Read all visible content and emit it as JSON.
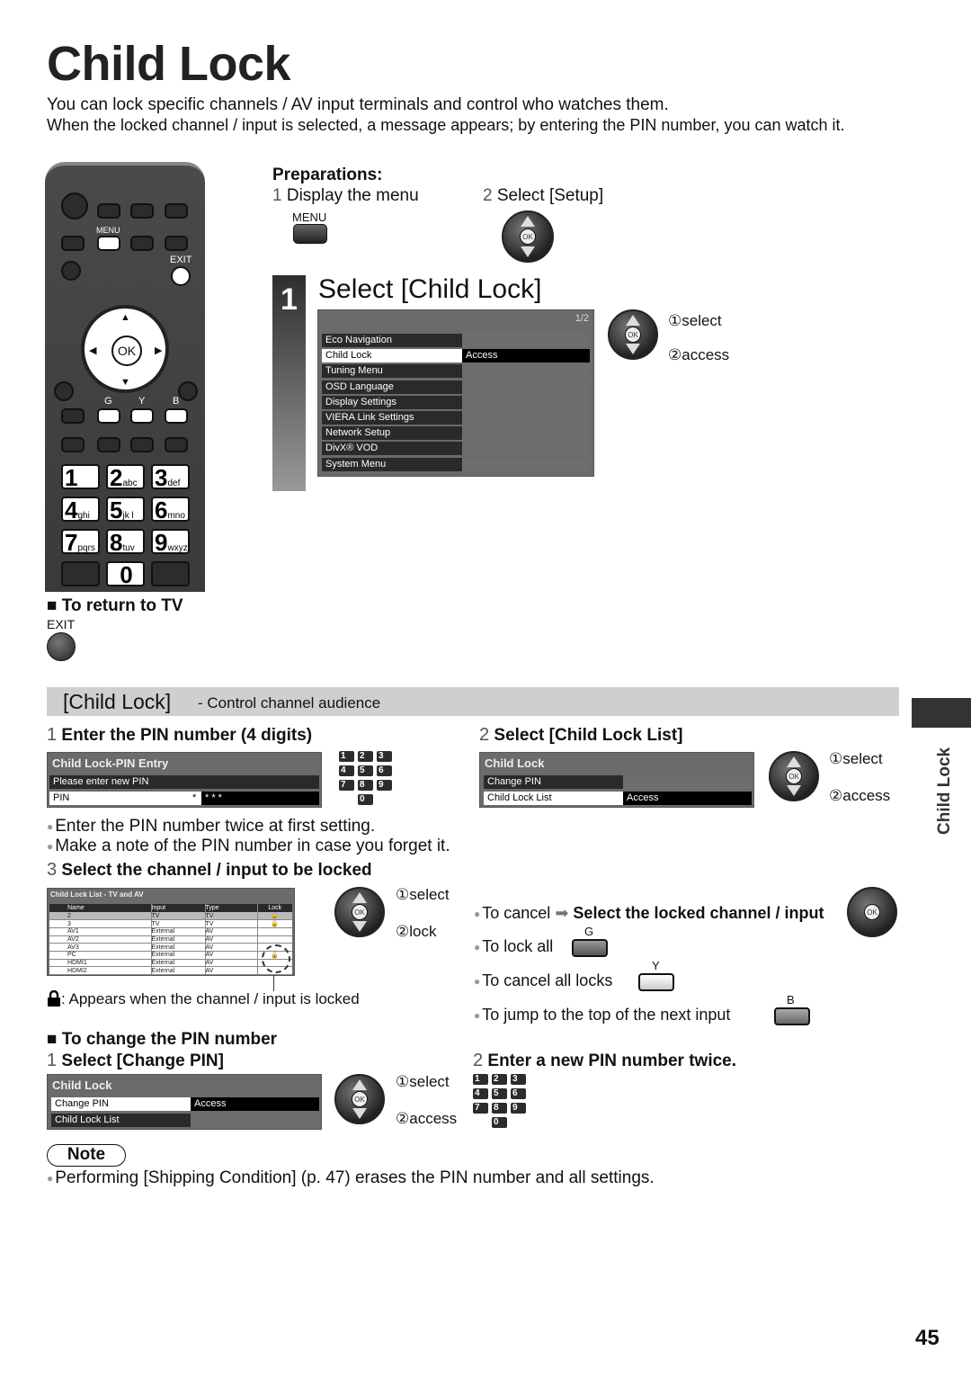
{
  "page": {
    "title": "Child Lock",
    "intro_line1": "You can lock specific channels / AV input terminals and control who watches them.",
    "intro_line2": "When the locked channel / input is selected, a message appears; by entering the PIN number, you can watch it.",
    "page_number": "45",
    "side_tab": "Child Lock"
  },
  "remote": {
    "menu_label": "MENU",
    "exit_label": "EXIT",
    "ok_label": "OK",
    "color_labels": [
      "G",
      "Y",
      "B"
    ],
    "numpad": [
      {
        "digit": "1",
        "letters": ""
      },
      {
        "digit": "2",
        "letters": "abc"
      },
      {
        "digit": "3",
        "letters": "def"
      },
      {
        "digit": "4",
        "letters": "ghi"
      },
      {
        "digit": "5",
        "letters": "jk l"
      },
      {
        "digit": "6",
        "letters": "mno"
      },
      {
        "digit": "7",
        "letters": "pqrs"
      },
      {
        "digit": "8",
        "letters": "tuv"
      },
      {
        "digit": "9",
        "letters": "wxyz"
      },
      {
        "digit": "0",
        "letters": ""
      }
    ]
  },
  "preparations": {
    "heading": "Preparations:",
    "step1_num": "1",
    "step1_text": "Display the menu",
    "step1_key": "MENU",
    "step2_num": "2",
    "step2_text": "Select [Setup]"
  },
  "return_tv": {
    "heading": "To return to TV",
    "key_label": "EXIT"
  },
  "step_select_child_lock": {
    "num": "1",
    "heading": "Select [Child Lock]",
    "page_indicator": "1/2",
    "items": [
      "Eco Navigation",
      "Child Lock",
      "Tuning Menu",
      "OSD Language",
      "Display Settings",
      "VIERA Link Settings",
      "Network Setup",
      "DivX® VOD",
      "System Menu"
    ],
    "selected_index": 1,
    "selected_value": "Access",
    "nav_select": "①select",
    "nav_access": "②access"
  },
  "section_bar": {
    "title": "[Child Lock]",
    "subtitle": " - Control channel audience"
  },
  "pin_entry": {
    "num": "1",
    "heading": "Enter the PIN number (4 digits)",
    "menu_title": "Child Lock-PIN Entry",
    "prompt": "Please enter new PIN",
    "field_label": "PIN",
    "field_value_first": "*",
    "field_value_rest": "*  *  *",
    "notes": [
      "Enter the PIN number twice at first setting.",
      "Make a note of the PIN number in case you forget it."
    ]
  },
  "lock_list_select": {
    "num": "2",
    "heading": "Select [Child Lock List]",
    "menu_title": "Child Lock",
    "items": [
      "Change PIN",
      "Child Lock List"
    ],
    "selected_index": 1,
    "selected_value": "Access",
    "nav_select": "①select",
    "nav_access": "②access"
  },
  "channel_lock": {
    "num": "3",
    "heading": "Select the channel / input to be locked",
    "list_title": "Child Lock List - TV and AV",
    "columns": [
      "Name",
      "Input",
      "Type",
      "Lock"
    ],
    "rows": [
      {
        "name": "2",
        "input": "TV",
        "type": "TV",
        "locked": true
      },
      {
        "name": "3",
        "input": "TV",
        "type": "TV",
        "locked": true
      },
      {
        "name": "AV1",
        "input": "External",
        "type": "AV",
        "locked": false
      },
      {
        "name": "AV2",
        "input": "External",
        "type": "AV",
        "locked": false
      },
      {
        "name": "AV3",
        "input": "External",
        "type": "AV",
        "locked": false
      },
      {
        "name": "PC",
        "input": "External",
        "type": "AV",
        "locked": true
      },
      {
        "name": "HDMI1",
        "input": "External",
        "type": "AV",
        "locked": false
      },
      {
        "name": "HDMI2",
        "input": "External",
        "type": "AV",
        "locked": false
      }
    ],
    "lock_legend": ": Appears when the channel / input is locked",
    "nav_select": "①select",
    "nav_lock": "②lock"
  },
  "tips": {
    "cancel_prefix": "To cancel",
    "cancel_action": "Select the locked channel / input",
    "lock_all": "To lock all",
    "lock_all_key": "G",
    "cancel_all": "To cancel all locks",
    "cancel_all_key": "Y",
    "jump_next": "To jump to the top of the next input",
    "jump_next_key": "B"
  },
  "change_pin": {
    "heading": "To change the PIN number",
    "step1_num": "1",
    "step1_heading": "Select [Change PIN]",
    "menu_title": "Child Lock",
    "items": [
      "Change PIN",
      "Child Lock List"
    ],
    "selected_index": 0,
    "selected_value": "Access",
    "nav_select": "①select",
    "nav_access": "②access",
    "step2_num": "2",
    "step2_heading": "Enter a new PIN number twice."
  },
  "note": {
    "label": "Note",
    "text": "Performing [Shipping Condition] (p. 47) erases the PIN number and all settings."
  },
  "colors": {
    "section_bar": "#cfcfcf",
    "menu_bg": "#6b6b6b",
    "menu_dark_row": "#2a2a2a",
    "side_tab": "#333333"
  }
}
